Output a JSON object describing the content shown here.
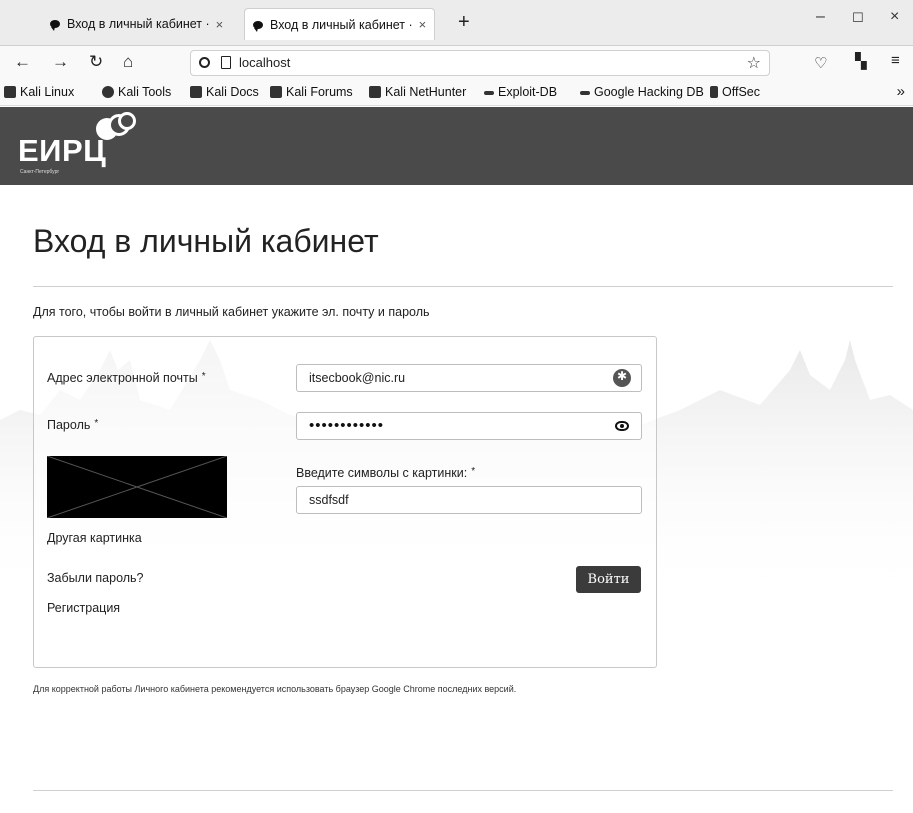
{
  "browser": {
    "tabs": [
      {
        "title": "Вход в личный кабинет ·",
        "active": false
      },
      {
        "title": "Вход в личный кабинет ·",
        "active": true
      }
    ],
    "url": "localhost",
    "bookmarks": [
      "Kali Linux",
      "Kali Tools",
      "Kali Docs",
      "Kali Forums",
      "Kali NetHunter",
      "Exploit-DB",
      "Google Hacking DB",
      "OffSec"
    ]
  },
  "site": {
    "logo": "ЕИРЦ",
    "logo_sub": "Санкт-Петербург"
  },
  "page": {
    "title": "Вход в личный кабинет",
    "intro": "Для того, чтобы войти в личный кабинет укажите эл. почту и пароль",
    "email_label": "Адрес электронной почты",
    "email_value": "itsecbook@nic.ru",
    "password_label": "Пароль",
    "password_mask": "••••••••••••",
    "captcha_label": "Введите символы с картинки:",
    "captcha_value": "ssdfsdf",
    "required_mark": "*",
    "other_image": "Другая картинка",
    "forgot": "Забыли пароль?",
    "register": "Регистрация",
    "login": "Войти",
    "note": "Для корректной работы Личного кабинета рекомендуется использовать браузер Google Chrome последних версий."
  }
}
